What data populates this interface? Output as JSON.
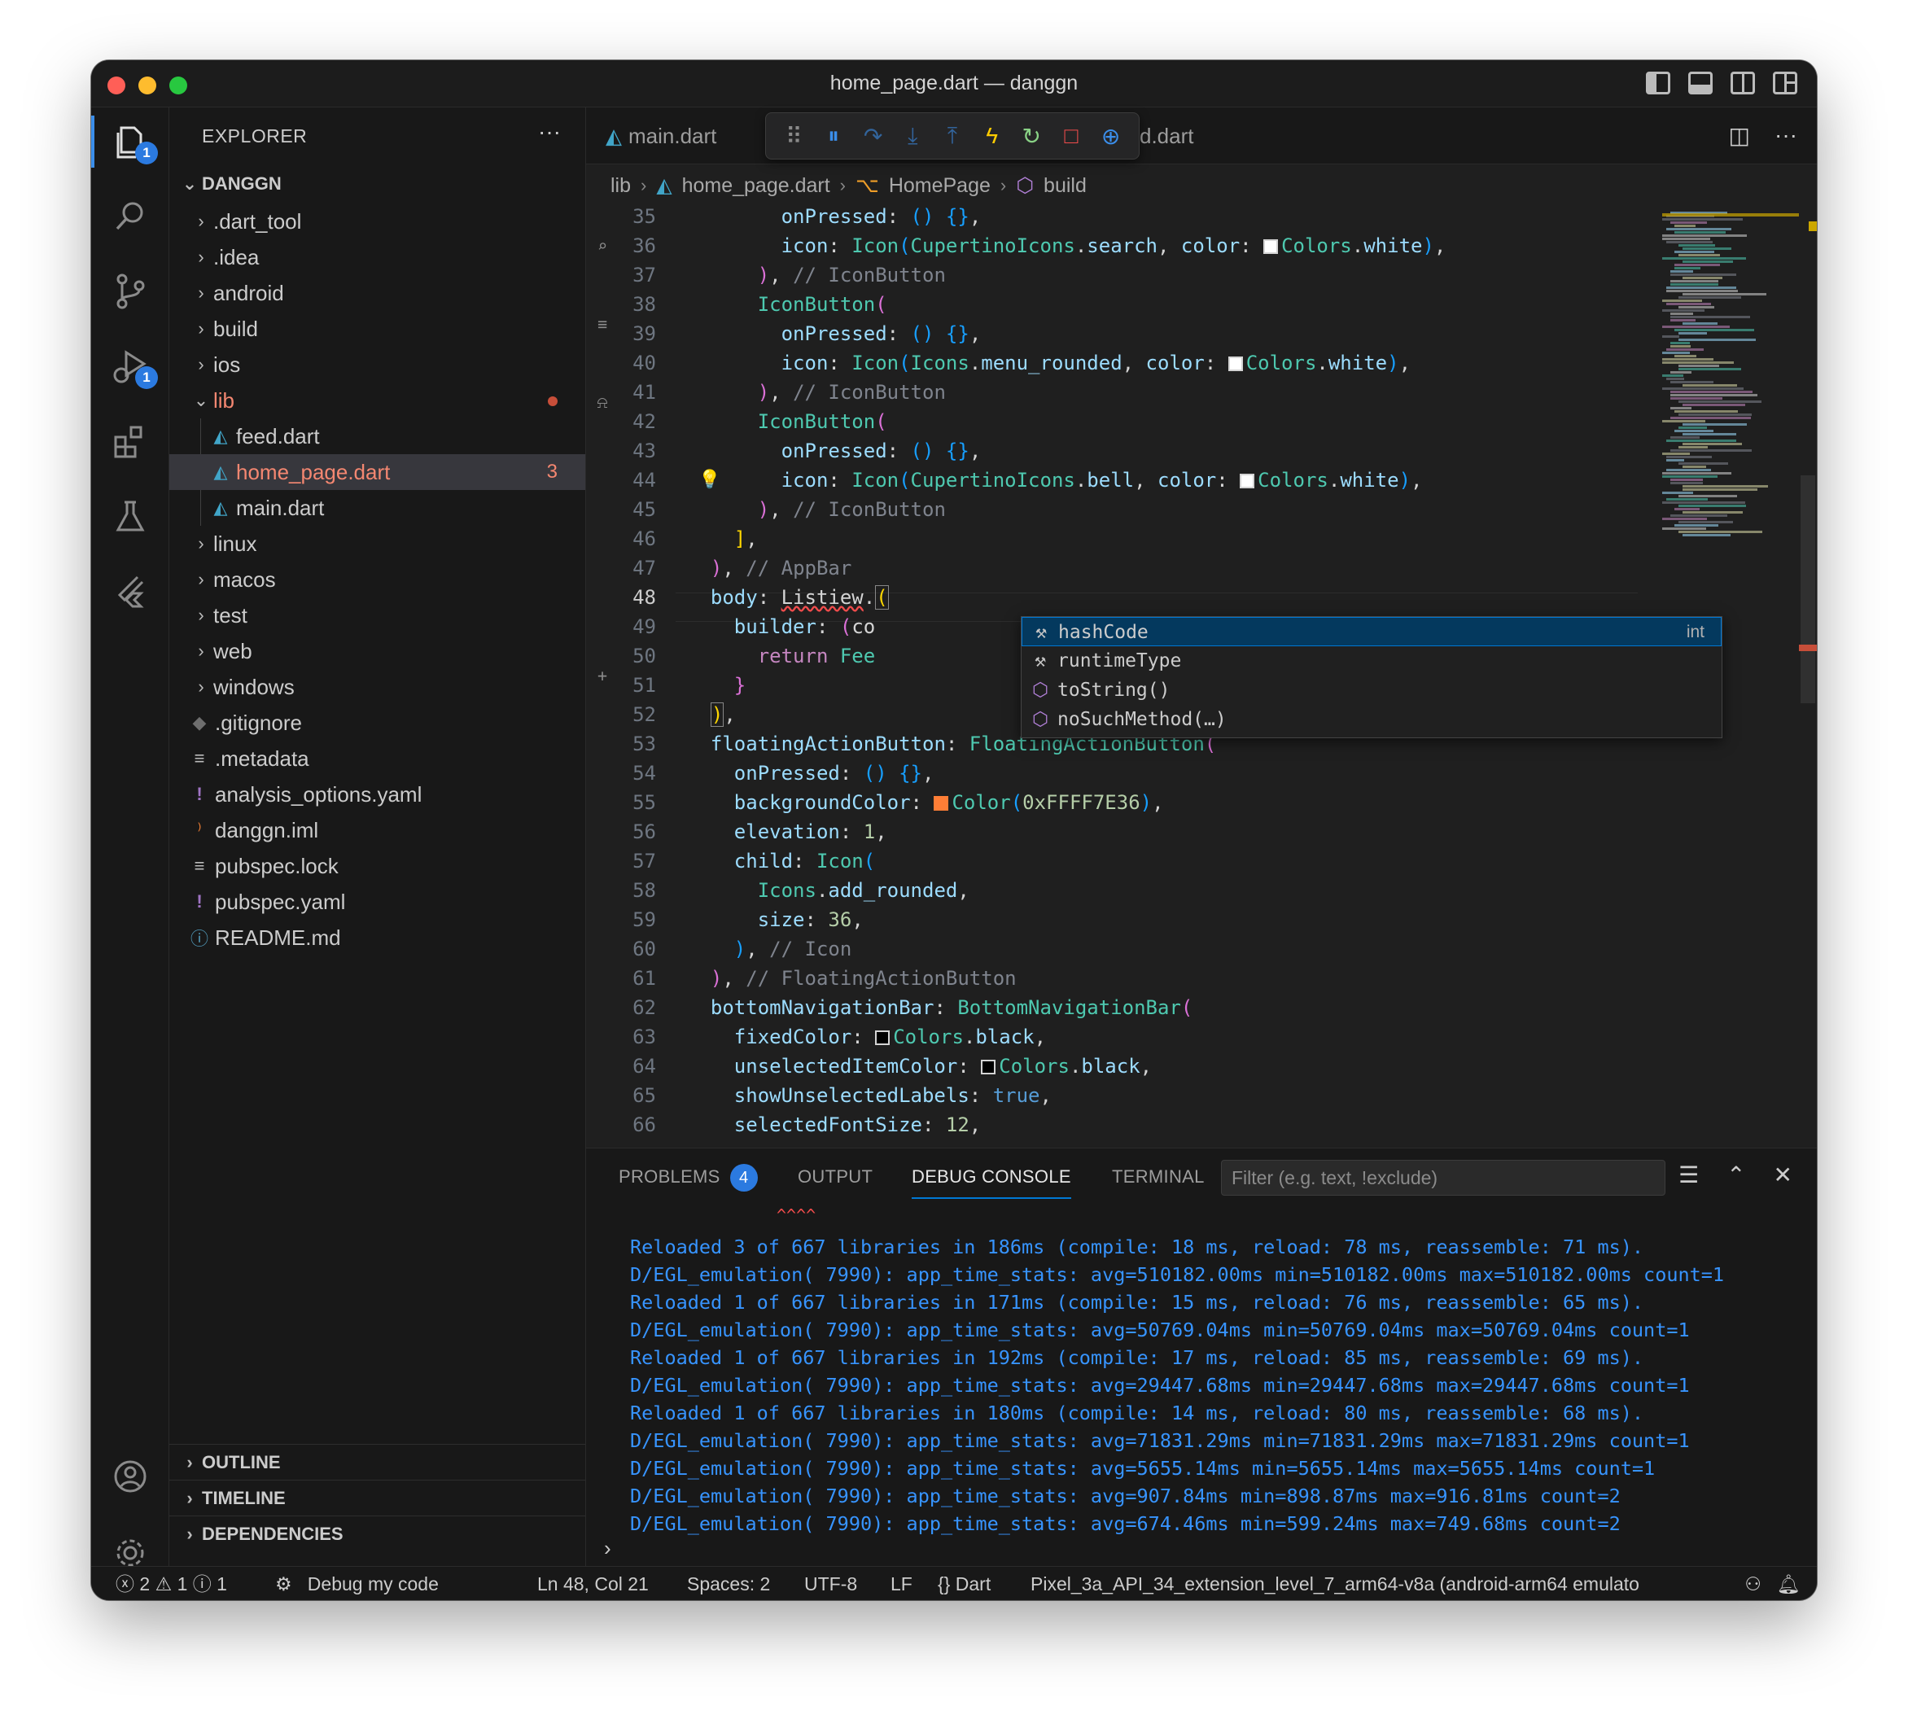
{
  "window": {
    "title": "home_page.dart — danggn"
  },
  "activity": {
    "explorer_badge": "1",
    "debug_badge": "1"
  },
  "sidebar": {
    "header": "EXPLORER",
    "more": "···",
    "root": "DANGGN",
    "items": [
      {
        "name": ".dart_tool",
        "type": "folder"
      },
      {
        "name": ".idea",
        "type": "folder"
      },
      {
        "name": "android",
        "type": "folder"
      },
      {
        "name": "build",
        "type": "folder"
      },
      {
        "name": "ios",
        "type": "folder"
      },
      {
        "name": "lib",
        "type": "folder-open"
      },
      {
        "name": "feed.dart",
        "type": "dart"
      },
      {
        "name": "home_page.dart",
        "type": "dart",
        "errors": "3"
      },
      {
        "name": "main.dart",
        "type": "dart"
      },
      {
        "name": "linux",
        "type": "folder"
      },
      {
        "name": "macos",
        "type": "folder"
      },
      {
        "name": "test",
        "type": "folder"
      },
      {
        "name": "web",
        "type": "folder"
      },
      {
        "name": "windows",
        "type": "folder"
      },
      {
        "name": ".gitignore",
        "type": "git"
      },
      {
        "name": ".metadata",
        "type": "lines"
      },
      {
        "name": "analysis_options.yaml",
        "type": "yaml"
      },
      {
        "name": "danggn.iml",
        "type": "rss"
      },
      {
        "name": "pubspec.lock",
        "type": "lines"
      },
      {
        "name": "pubspec.yaml",
        "type": "yaml"
      },
      {
        "name": "README.md",
        "type": "info"
      }
    ],
    "sections": [
      "OUTLINE",
      "TIMELINE",
      "DEPENDENCIES"
    ]
  },
  "tabs": {
    "first": "main.dart",
    "second_partial": "d.dart"
  },
  "breadcrumb": {
    "lib": "lib",
    "file": "home_page.dart",
    "class": "HomePage",
    "method": "build"
  },
  "editor": {
    "current_line": "48",
    "line_numbers": [
      "35",
      "36",
      "37",
      "38",
      "39",
      "40",
      "41",
      "42",
      "43",
      "44",
      "45",
      "46",
      "47",
      "48",
      "49",
      "50",
      "51",
      "52",
      "53",
      "54",
      "55",
      "56",
      "57",
      "58",
      "59",
      "60",
      "61",
      "62",
      "63",
      "64",
      "65",
      "66"
    ],
    "suggestions": [
      {
        "label": "hashCode",
        "detail": "int"
      },
      {
        "label": "runtimeType",
        "detail": ""
      },
      {
        "label": "toString()",
        "detail": ""
      },
      {
        "label": "noSuchMethod(…)",
        "detail": ""
      }
    ]
  },
  "panel": {
    "tabs": {
      "problems": "PROBLEMS",
      "problems_count": "4",
      "output": "OUTPUT",
      "debug_console": "DEBUG CONSOLE",
      "terminal": "TERMINAL"
    },
    "filter_placeholder": "Filter (e.g. text, !exclude)",
    "carets": "^^^^",
    "console_lines": [
      "Reloaded 3 of 667 libraries in 186ms (compile: 18 ms, reload: 78 ms, reassemble: 71 ms).",
      "D/EGL_emulation( 7990): app_time_stats: avg=510182.00ms min=510182.00ms max=510182.00ms count=1",
      "Reloaded 1 of 667 libraries in 171ms (compile: 15 ms, reload: 76 ms, reassemble: 65 ms).",
      "D/EGL_emulation( 7990): app_time_stats: avg=50769.04ms min=50769.04ms max=50769.04ms count=1",
      "Reloaded 1 of 667 libraries in 192ms (compile: 17 ms, reload: 85 ms, reassemble: 69 ms).",
      "D/EGL_emulation( 7990): app_time_stats: avg=29447.68ms min=29447.68ms max=29447.68ms count=1",
      "Reloaded 1 of 667 libraries in 180ms (compile: 14 ms, reload: 80 ms, reassemble: 68 ms).",
      "D/EGL_emulation( 7990): app_time_stats: avg=71831.29ms min=71831.29ms max=71831.29ms count=1",
      "D/EGL_emulation( 7990): app_time_stats: avg=5655.14ms min=5655.14ms max=5655.14ms count=1",
      "D/EGL_emulation( 7990): app_time_stats: avg=907.84ms min=898.87ms max=916.81ms count=2",
      "D/EGL_emulation( 7990): app_time_stats: avg=674.46ms min=599.24ms max=749.68ms count=2"
    ]
  },
  "status": {
    "errors": "2",
    "warnings": "1",
    "infos": "1",
    "debug_config": "Debug my code",
    "position": "Ln 48, Col 21",
    "spaces": "Spaces: 2",
    "encoding": "UTF-8",
    "eol": "LF",
    "language": "Dart",
    "device": "Pixel_3a_API_34_extension_level_7_arm64-v8a (android-arm64 emulato"
  },
  "colors": {
    "accent": "#0078d4",
    "badge": "#2b7ae0",
    "error": "#f48771",
    "console": "#3794ff"
  }
}
